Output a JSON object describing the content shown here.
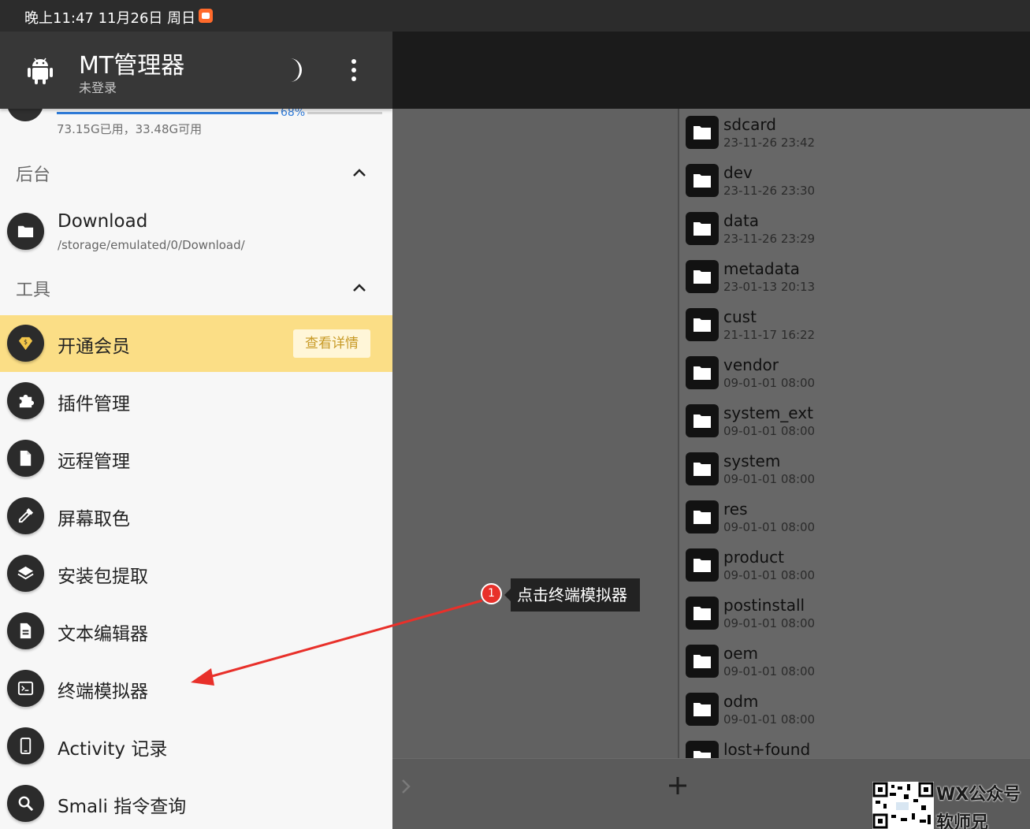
{
  "status_bar": {
    "time": "晚上11:47  11月26日 周日"
  },
  "header": {
    "title": "MT管理器",
    "subtitle": "未登录"
  },
  "storage": {
    "percent_label": "68%",
    "used_fraction": 0.68,
    "usage_text": "73.15G已用，33.48G可用"
  },
  "sections": {
    "background": "后台",
    "tools": "工具"
  },
  "download": {
    "title": "Download",
    "path": "/storage/emulated/0/Download/"
  },
  "tools": [
    {
      "label": "开通会员",
      "action": "查看详情"
    },
    {
      "label": "插件管理"
    },
    {
      "label": "远程管理"
    },
    {
      "label": "屏幕取色"
    },
    {
      "label": "安装包提取"
    },
    {
      "label": "文本编辑器"
    },
    {
      "label": "终端模拟器"
    },
    {
      "label": "Activity 记录"
    },
    {
      "label": "Smali 指令查询"
    }
  ],
  "files": [
    {
      "name": "sdcard",
      "date": "23-11-26 23:42"
    },
    {
      "name": "dev",
      "date": "23-11-26 23:30"
    },
    {
      "name": "data",
      "date": "23-11-26 23:29"
    },
    {
      "name": "metadata",
      "date": "23-01-13 20:13"
    },
    {
      "name": "cust",
      "date": "21-11-17 16:22"
    },
    {
      "name": "vendor",
      "date": "09-01-01 08:00"
    },
    {
      "name": "system_ext",
      "date": "09-01-01 08:00"
    },
    {
      "name": "system",
      "date": "09-01-01 08:00"
    },
    {
      "name": "res",
      "date": "09-01-01 08:00"
    },
    {
      "name": "product",
      "date": "09-01-01 08:00"
    },
    {
      "name": "postinstall",
      "date": "09-01-01 08:00"
    },
    {
      "name": "oem",
      "date": "09-01-01 08:00"
    },
    {
      "name": "odm",
      "date": "09-01-01 08:00"
    },
    {
      "name": "lost+found",
      "date": ""
    }
  ],
  "annotation": {
    "step": "1",
    "text": "点击终端模拟器"
  },
  "watermark": {
    "line1": "WX公众号",
    "line2": "软师兄"
  },
  "colors": {
    "vip": "#fbde86",
    "accent": "#2f7bd9",
    "badge": "#e8302a"
  }
}
